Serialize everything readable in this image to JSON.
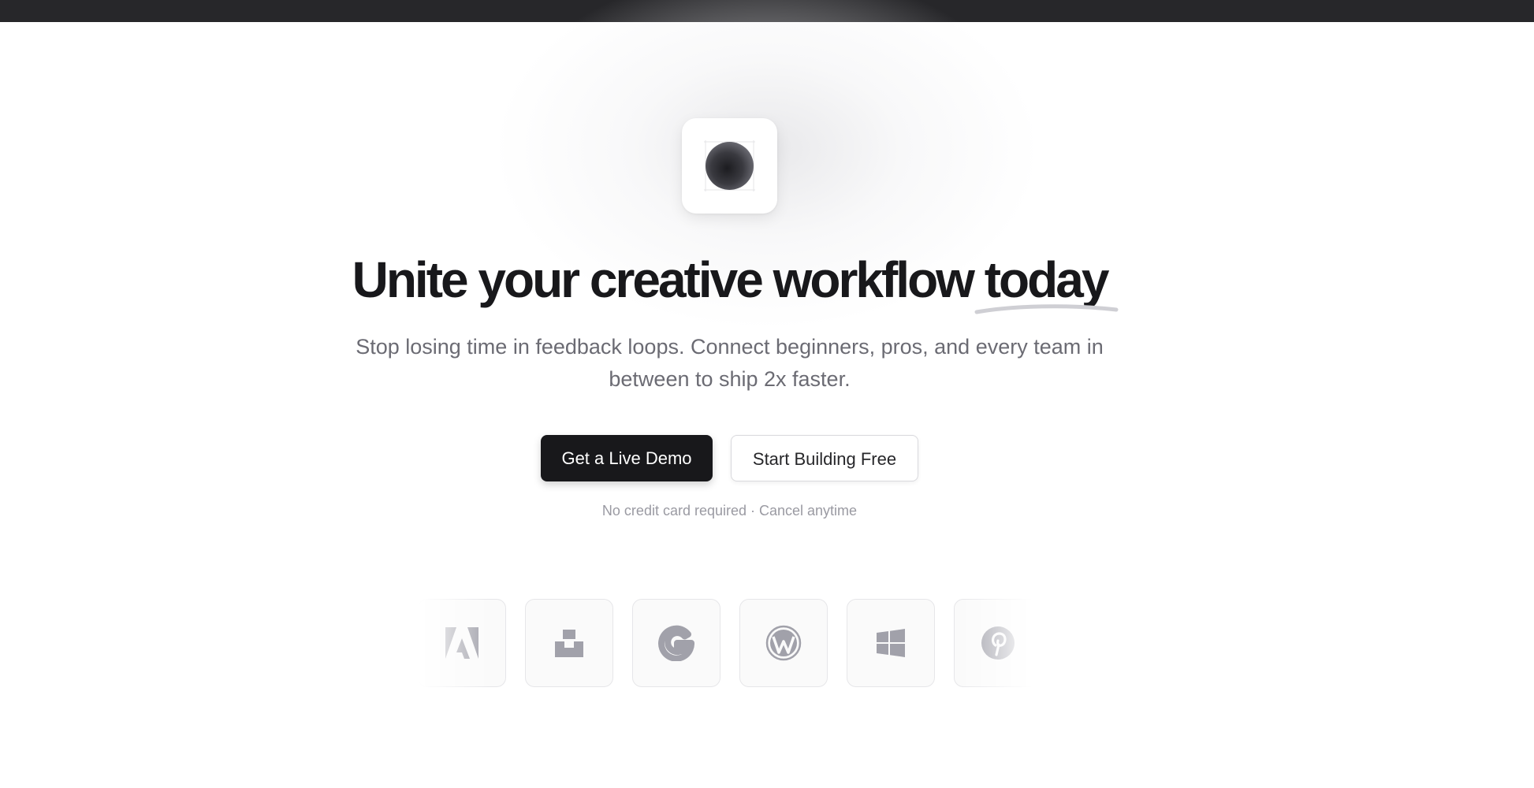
{
  "hero": {
    "headline_main": "Unite your creative workflow ",
    "headline_emphasis": "today",
    "subtitle": "Stop losing time in feedback loops. Connect beginners, pros, and every team in between to ship 2x faster.",
    "note": "No credit card required · Cancel anytime"
  },
  "buttons": {
    "primary_label": "Get a Live Demo",
    "secondary_label": "Start Building Free"
  },
  "logos": [
    {
      "name": "adobe-icon"
    },
    {
      "name": "unsplash-icon"
    },
    {
      "name": "google-icon"
    },
    {
      "name": "wordpress-icon"
    },
    {
      "name": "windows-icon"
    },
    {
      "name": "pinterest-icon"
    }
  ],
  "colors": {
    "topbar": "#27272a",
    "text_dark": "#18181b",
    "text_muted": "#6b6b73",
    "logo_gray": "#a1a1aa"
  }
}
